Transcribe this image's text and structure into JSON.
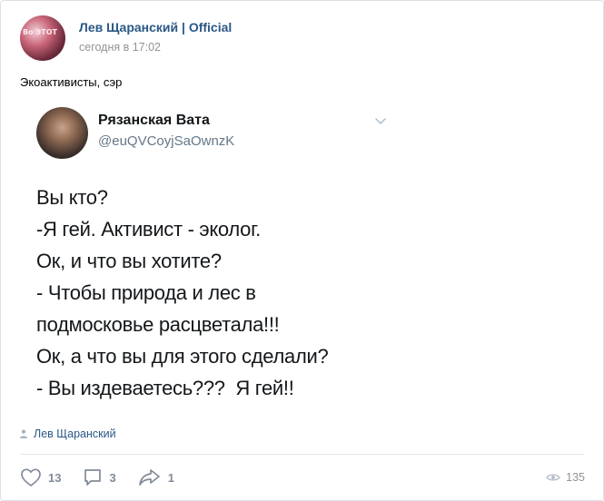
{
  "post": {
    "author": "Лев Щаранский | Official",
    "time": "сегодня в 17:02",
    "text": "Экоактивисты, сэр",
    "avatar_overlay": "Во\nЭТОТ"
  },
  "tweet": {
    "name": "Рязанская Вата",
    "handle": "@euQVCoyjSaOwnzK",
    "lines": [
      "Вы кто?",
      "-Я гей. Активист - эколог.",
      "Ок, и что вы хотите?",
      "- Чтобы природа и лес в",
      "подмосковье расцветала!!!",
      "Ок, а что вы для этого сделали?",
      "- Вы издеваетесь???  Я гей!!"
    ]
  },
  "source": {
    "label": "Лев Щаранский"
  },
  "actions": {
    "likes": "13",
    "comments": "3",
    "shares": "1",
    "views": "135"
  },
  "colors": {
    "link": "#2a5885",
    "icon": "#828a99",
    "muted": "#939393"
  }
}
